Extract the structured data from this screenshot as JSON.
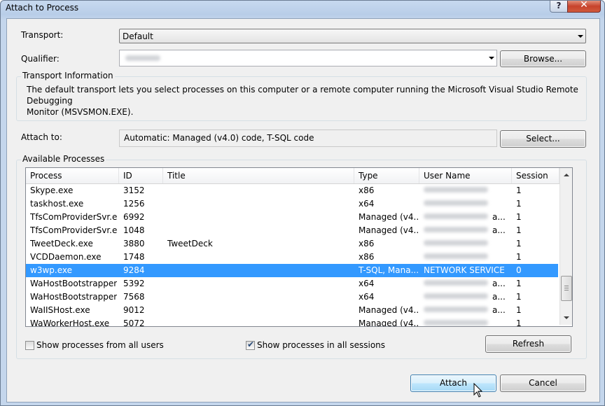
{
  "window": {
    "title": "Attach to Process",
    "help": "?",
    "close": "✕"
  },
  "transport": {
    "label": "Transport:",
    "value": "Default"
  },
  "qualifier": {
    "label": "Qualifier:",
    "browse": "Browse..."
  },
  "transport_info": {
    "label": "Transport Information",
    "line1": "The default transport lets you select processes on this computer or a remote computer running the Microsoft Visual Studio Remote Debugging",
    "line2": "Monitor (MSVSMON.EXE)."
  },
  "attach_to": {
    "label": "Attach to:",
    "value": "Automatic: Managed (v4.0) code, T-SQL code",
    "select": "Select..."
  },
  "available": {
    "label": "Available Processes",
    "columns": [
      "Process",
      "ID",
      "Title",
      "Type",
      "User Name",
      "Session"
    ],
    "rows": [
      {
        "process": "Skype.exe",
        "id": "3152",
        "title": "",
        "type": "x86",
        "user": "",
        "session": "1"
      },
      {
        "process": "taskhost.exe",
        "id": "1256",
        "title": "",
        "type": "x64",
        "user": "",
        "session": "1"
      },
      {
        "process": "TfsComProviderSvr.exe",
        "id": "6992",
        "title": "",
        "type": "Managed (v4....",
        "user": "a...",
        "session": "1"
      },
      {
        "process": "TfsComProviderSvr.exe",
        "id": "1048",
        "title": "",
        "type": "Managed (v4....",
        "user": "a...",
        "session": "1"
      },
      {
        "process": "TweetDeck.exe",
        "id": "3880",
        "title": "TweetDeck",
        "type": "x86",
        "user": "",
        "session": "1"
      },
      {
        "process": "VCDDaemon.exe",
        "id": "1748",
        "title": "",
        "type": "x86",
        "user": "",
        "session": "1"
      },
      {
        "process": "w3wp.exe",
        "id": "9284",
        "title": "",
        "type": "T-SQL, Mana...",
        "user": "NETWORK SERVICE",
        "session": "0"
      },
      {
        "process": "WaHostBootstrapper....",
        "id": "5392",
        "title": "",
        "type": "x64",
        "user": "a...",
        "session": "1"
      },
      {
        "process": "WaHostBootstrapper....",
        "id": "7568",
        "title": "",
        "type": "x64",
        "user": "a...",
        "session": "1"
      },
      {
        "process": "WaIISHost.exe",
        "id": "9012",
        "title": "",
        "type": "Managed (v4....",
        "user": "a...",
        "session": "1"
      },
      {
        "process": "WaWorkerHost.exe",
        "id": "5072",
        "title": "",
        "type": "Managed (v4....",
        "user": "",
        "session": "1"
      }
    ],
    "selected_index": 6
  },
  "options": {
    "all_users": "Show processes from all users",
    "all_users_checked": false,
    "all_sessions": "Show processes in all sessions",
    "all_sessions_checked": true,
    "refresh": "Refresh"
  },
  "footer": {
    "attach": "Attach",
    "cancel": "Cancel"
  }
}
